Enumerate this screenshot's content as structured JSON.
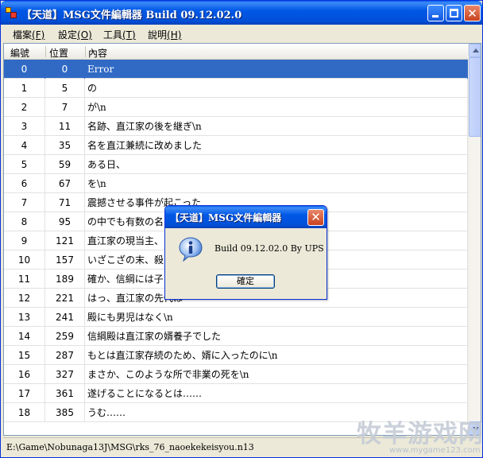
{
  "window": {
    "title": "【天道】MSG文件編輯器 Build 09.12.02.0",
    "minimize_label": "",
    "close_label": "✕"
  },
  "menu": {
    "items": [
      {
        "label": "檔案",
        "mnemonic": "(F)"
      },
      {
        "label": "設定",
        "mnemonic": "(O)"
      },
      {
        "label": "工具",
        "mnemonic": "(T)"
      },
      {
        "label": "說明",
        "mnemonic": "(H)"
      }
    ]
  },
  "grid": {
    "headers": [
      "編號",
      "位置",
      "內容"
    ],
    "rows": [
      {
        "id": "0",
        "pos": "0",
        "text": "Error"
      },
      {
        "id": "1",
        "pos": "5",
        "text": "の"
      },
      {
        "id": "2",
        "pos": "7",
        "text": "が\\n"
      },
      {
        "id": "3",
        "pos": "11",
        "text": "名跡、直江家の後を継ぎ\\n"
      },
      {
        "id": "4",
        "pos": "35",
        "text": "名を直江兼続に改めました"
      },
      {
        "id": "5",
        "pos": "59",
        "text": "ある日、"
      },
      {
        "id": "6",
        "pos": "67",
        "text": "を\\n"
      },
      {
        "id": "7",
        "pos": "71",
        "text": "震撼させる事件が起こった"
      },
      {
        "id": "8",
        "pos": "95",
        "text": "の中でも有数の名"
      },
      {
        "id": "9",
        "pos": "121",
        "text": "直江家の現当主、"
      },
      {
        "id": "10",
        "pos": "157",
        "text": "いざこざの末、殺"
      },
      {
        "id": "11",
        "pos": "189",
        "text": "確か、信綱には子"
      },
      {
        "id": "12",
        "pos": "221",
        "text": "はっ、直江家の先代は"
      },
      {
        "id": "13",
        "pos": "241",
        "text": "殿にも男児はなく\\n"
      },
      {
        "id": "14",
        "pos": "259",
        "text": "信綱殿は直江家の婿養子でした"
      },
      {
        "id": "15",
        "pos": "287",
        "text": "もとは直江家存続のため、婿に入ったのに\\n"
      },
      {
        "id": "16",
        "pos": "327",
        "text": "まさか、このような所で非業の死を\\n"
      },
      {
        "id": "17",
        "pos": "361",
        "text": "遂げることになるとは……"
      },
      {
        "id": "18",
        "pos": "385",
        "text": "うむ……"
      }
    ],
    "selected_index": 0
  },
  "status": {
    "path": "E:\\Game\\Nobunaga13J\\MSG\\rks_76_naoekekeisyou.n13"
  },
  "dialog": {
    "title": "【天道】MSG文件編輯器",
    "message": "Build 09.12.02.0 By UPS",
    "ok_label": "確定",
    "close_label": "✕"
  },
  "watermark": {
    "text": "牧羊游戏网",
    "url": "www.mygame123.com"
  },
  "colors": {
    "titlebar": "#0058e6",
    "selection": "#316ac5",
    "window_bg": "#ece9d8"
  }
}
